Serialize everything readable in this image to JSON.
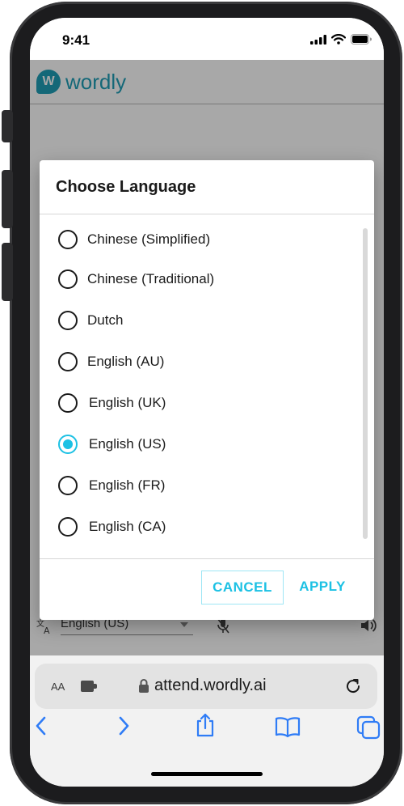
{
  "status_bar": {
    "time": "9:41",
    "icons": [
      "cellular-signal-icon",
      "wifi-icon",
      "battery-icon"
    ]
  },
  "app": {
    "logo_letter": "W",
    "brand_name": "wordly",
    "brand_color": "#1f9fb7",
    "bottom_bar": {
      "selected_language": "English (US)",
      "icons": [
        "translate-icon",
        "microphone-off-icon",
        "speaker-icon"
      ]
    }
  },
  "dialog": {
    "title": "Choose Language",
    "accent_color": "#1cc1e4",
    "options": [
      {
        "label": "Chinese (Simplified)",
        "selected": false
      },
      {
        "label": "Chinese (Traditional)",
        "selected": false
      },
      {
        "label": "Dutch",
        "selected": false
      },
      {
        "label": "English (AU)",
        "selected": false
      },
      {
        "label": "English (UK)",
        "selected": false
      },
      {
        "label": "English (US)",
        "selected": true
      },
      {
        "label": "English (FR)",
        "selected": false
      },
      {
        "label": "English (CA)",
        "selected": false
      }
    ],
    "cancel_label": "CANCEL",
    "apply_label": "APPLY"
  },
  "browser": {
    "aa_label": "AA",
    "url": "attend.wordly.ai",
    "icons": [
      "extension-icon",
      "lock-icon",
      "reload-icon",
      "back-icon",
      "forward-icon",
      "share-icon",
      "bookmarks-icon",
      "tabs-icon"
    ]
  }
}
